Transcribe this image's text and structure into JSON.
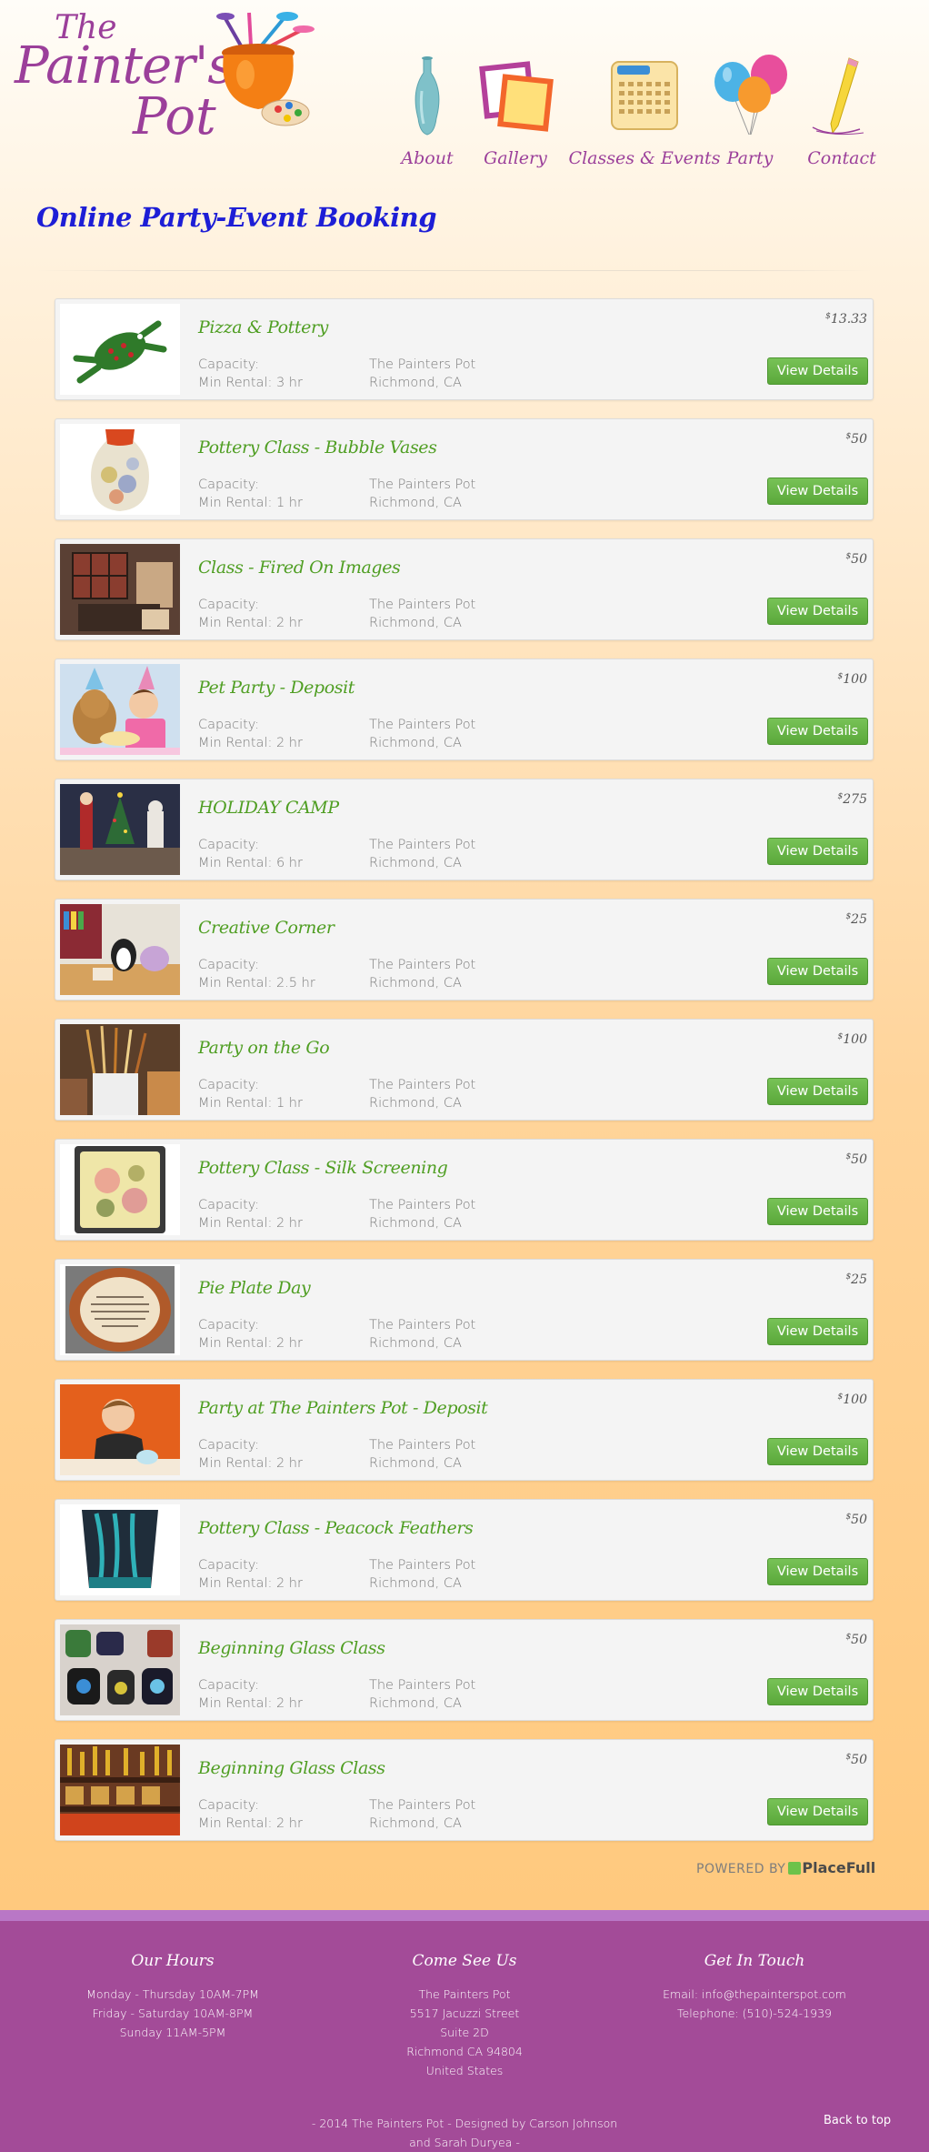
{
  "logo": {
    "line1": "The",
    "line2": "Painter's",
    "line3": "Pot"
  },
  "nav": [
    {
      "label": "About",
      "icon": "vase-icon"
    },
    {
      "label": "Gallery",
      "icon": "picture-frames-icon"
    },
    {
      "label": "Classes & Events",
      "icon": "calendar-icon"
    },
    {
      "label": "Party",
      "icon": "balloons-icon"
    },
    {
      "label": "Contact",
      "icon": "pencil-icon"
    }
  ],
  "page_title": "Online Party-Event Booking",
  "capacity_label": "Capacity:",
  "button_label": "View Details",
  "listings": [
    {
      "title": "Pizza & Pottery",
      "price_symbol": "$",
      "price": "13.33",
      "min_rental": "Min Rental: 3 hr",
      "location_name": "The Painters Pot",
      "location_city": "Richmond, CA",
      "thumb": "frog-figurine"
    },
    {
      "title": "Pottery Class - Bubble Vases",
      "price_symbol": "$",
      "price": "50",
      "min_rental": "Min Rental: 1 hr",
      "location_name": "The Painters Pot",
      "location_city": "Richmond, CA",
      "thumb": "bubble-vase"
    },
    {
      "title": "Class - Fired On Images",
      "price_symbol": "$",
      "price": "50",
      "min_rental": "Min Rental: 2 hr",
      "location_name": "The Painters Pot",
      "location_city": "Richmond, CA",
      "thumb": "photo-tiles"
    },
    {
      "title": "Pet Party - Deposit",
      "price_symbol": "$",
      "price": "100",
      "min_rental": "Min Rental: 2 hr",
      "location_name": "The Painters Pot",
      "location_city": "Richmond, CA",
      "thumb": "pet-party"
    },
    {
      "title": "HOLIDAY CAMP",
      "price_symbol": "$",
      "price": "275",
      "min_rental": "Min Rental: 6 hr",
      "location_name": "The Painters Pot",
      "location_city": "Richmond, CA",
      "thumb": "holiday-figures"
    },
    {
      "title": "Creative Corner",
      "price_symbol": "$",
      "price": "25",
      "min_rental": "Min Rental: 2.5 hr",
      "location_name": "The Painters Pot",
      "location_city": "Richmond, CA",
      "thumb": "creative-corner"
    },
    {
      "title": "Party on the Go",
      "price_symbol": "$",
      "price": "100",
      "min_rental": "Min Rental: 1 hr",
      "location_name": "The Painters Pot",
      "location_city": "Richmond, CA",
      "thumb": "brushes-cup"
    },
    {
      "title": "Pottery Class - Silk Screening",
      "price_symbol": "$",
      "price": "50",
      "min_rental": "Min Rental: 2 hr",
      "location_name": "The Painters Pot",
      "location_city": "Richmond, CA",
      "thumb": "silk-screen-plate"
    },
    {
      "title": "Pie Plate Day",
      "price_symbol": "$",
      "price": "25",
      "min_rental": "Min Rental: 2 hr",
      "location_name": "The Painters Pot",
      "location_city": "Richmond, CA",
      "thumb": "pie-plate"
    },
    {
      "title": "Party at The Painters Pot - Deposit",
      "price_symbol": "$",
      "price": "100",
      "min_rental": "Min Rental: 2 hr",
      "location_name": "The Painters Pot",
      "location_city": "Richmond, CA",
      "thumb": "boy-painting"
    },
    {
      "title": "Pottery Class - Peacock Feathers",
      "price_symbol": "$",
      "price": "50",
      "min_rental": "Min Rental: 2 hr",
      "location_name": "The Painters Pot",
      "location_city": "Richmond, CA",
      "thumb": "peacock-plate"
    },
    {
      "title": "Beginning Glass Class",
      "price_symbol": "$",
      "price": "50",
      "min_rental": "Min Rental: 2 hr",
      "location_name": "The Painters Pot",
      "location_city": "Richmond, CA",
      "thumb": "glass-pieces"
    },
    {
      "title": "Beginning Glass Class",
      "price_symbol": "$",
      "price": "50",
      "min_rental": "Min Rental: 2 hr",
      "location_name": "The Painters Pot",
      "location_city": "Richmond, CA",
      "thumb": "glass-shelf"
    }
  ],
  "powered_by": {
    "prefix": "POWERED BY",
    "brand": "PlaceFull"
  },
  "footer": {
    "hours": {
      "heading": "Our Hours",
      "lines": [
        "Monday - Thursday 10AM-7PM",
        "Friday - Saturday 10AM-8PM",
        "Sunday 11AM-5PM"
      ]
    },
    "visit": {
      "heading": "Come See Us",
      "lines": [
        "The Painters Pot",
        "5517 Jacuzzi Street",
        "Suite 2D",
        "Richmond CA 94804",
        "United States"
      ]
    },
    "contact": {
      "heading": "Get In Touch",
      "lines": [
        "Email: info@thepainterspot.com",
        "Telephone: (510)-524-1939"
      ]
    },
    "copyright": "- 2014 The Painters Pot - Designed by Carson Johnson and Sarah Duryea -",
    "back_to_top": "Back to top"
  },
  "colors": {
    "brand_purple": "#9b3f9a",
    "title_blue": "#1d1ed6",
    "listing_green": "#4f9e22",
    "button_green": "#5aa83a",
    "footer_purple": "#a34b98"
  }
}
